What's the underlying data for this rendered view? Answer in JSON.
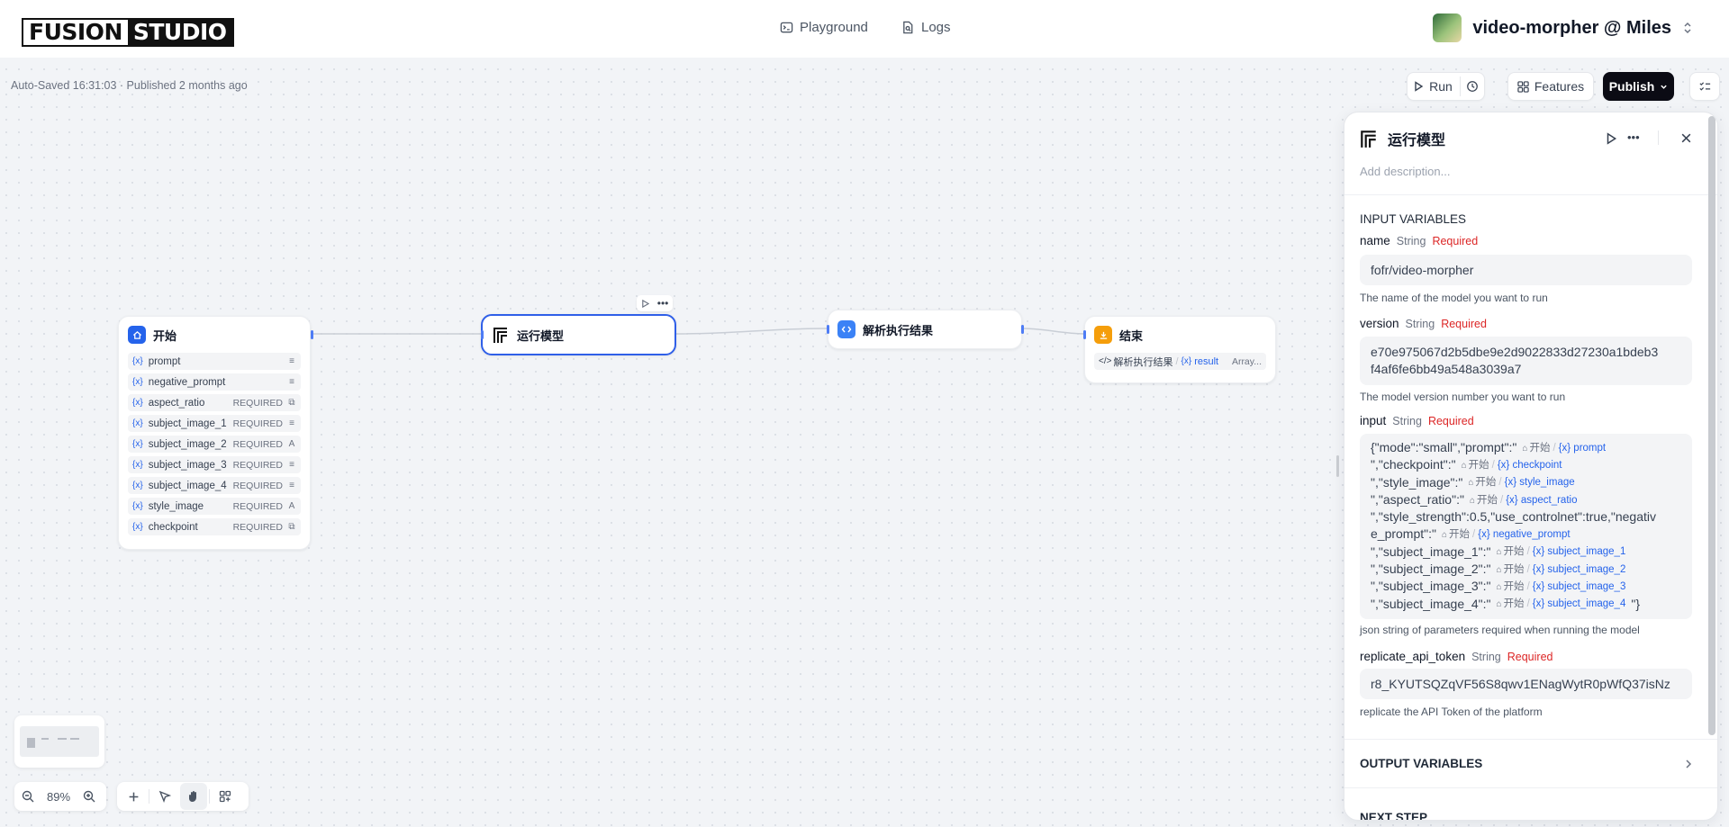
{
  "header": {
    "logo_left": "FUSION",
    "logo_right": "STUDIO",
    "tabs": [
      {
        "label": "Playground",
        "icon": "terminal-icon"
      },
      {
        "label": "Logs",
        "icon": "file-search-icon"
      }
    ],
    "app_name": "video-morpher @ Miles"
  },
  "toolbar": {
    "autosave": "Auto-Saved 16:31:03 · Published 2 months ago",
    "run_label": "Run",
    "features_label": "Features",
    "publish_label": "Publish"
  },
  "nodes": {
    "start": {
      "title": "开始",
      "vars": [
        {
          "name": "prompt",
          "required": "",
          "type_icon": "≡"
        },
        {
          "name": "negative_prompt",
          "required": "",
          "type_icon": "≡"
        },
        {
          "name": "aspect_ratio",
          "required": "REQUIRED",
          "type_icon": "⧉"
        },
        {
          "name": "subject_image_1",
          "required": "REQUIRED",
          "type_icon": "≡"
        },
        {
          "name": "subject_image_2",
          "required": "REQUIRED",
          "type_icon": "A"
        },
        {
          "name": "subject_image_3",
          "required": "REQUIRED",
          "type_icon": "≡"
        },
        {
          "name": "subject_image_4",
          "required": "REQUIRED",
          "type_icon": "≡"
        },
        {
          "name": "style_image",
          "required": "REQUIRED",
          "type_icon": "A"
        },
        {
          "name": "checkpoint",
          "required": "REQUIRED",
          "type_icon": "⧉"
        }
      ]
    },
    "run_model": {
      "title": "运行模型"
    },
    "parse": {
      "title": "解析执行结果"
    },
    "end": {
      "title": "结束",
      "output_source": "解析执行结果",
      "output_var": "result",
      "output_type": "Array..."
    }
  },
  "panel": {
    "title": "运行模型",
    "description_placeholder": "Add description...",
    "input_header": "INPUT VARIABLES",
    "fields": [
      {
        "label": "name",
        "type": "String",
        "required": "Required",
        "value": "fofr/video-morpher",
        "description": "The name of the model you want to run"
      },
      {
        "label": "version",
        "type": "String",
        "required": "Required",
        "value_line1": "e70e975067d2b5dbe9e2d9022833d27230a1bdeb3",
        "value_line2": "f4af6fe6bb49a548a3039a7",
        "description": "The model version number you want to run"
      },
      {
        "label": "input",
        "type": "String",
        "required": "Required",
        "description": "json string of parameters required when running the model"
      },
      {
        "label": "replicate_api_token",
        "type": "String",
        "required": "Required",
        "value": "r8_KYUTSQZqVF56S8qwv1ENagWytR0pWfQ37isNz",
        "description": "replicate the API Token of the platform"
      }
    ],
    "input_json": [
      {
        "text": "{\"mode\":\"small\",\"prompt\":\"",
        "src": "开始",
        "var": "prompt"
      },
      {
        "text": "\",\"checkpoint\":\"",
        "src": "开始",
        "var": "checkpoint"
      },
      {
        "text": "\",\"style_image\":\"",
        "src": "开始",
        "var": "style_image"
      },
      {
        "text": "\",\"aspect_ratio\":\"",
        "src": "开始",
        "var": "aspect_ratio"
      },
      {
        "text": "\",\"style_strength\":0.5,\"use_controlnet\":true,\"negativ",
        "src": "",
        "var": ""
      },
      {
        "text": "e_prompt\":\"",
        "src": "开始",
        "var": "negative_prompt"
      },
      {
        "text": "\",\"subject_image_1\":\"",
        "src": "开始",
        "var": "subject_image_1"
      },
      {
        "text": "\",\"subject_image_2\":\"",
        "src": "开始",
        "var": "subject_image_2"
      },
      {
        "text": "\",\"subject_image_3\":\"",
        "src": "开始",
        "var": "subject_image_3"
      },
      {
        "text": "\",\"subject_image_4\":\"",
        "src": "开始",
        "var": "subject_image_4",
        "tail": "\"}"
      }
    ],
    "output_header": "OUTPUT VARIABLES",
    "next_header": "NEXT STEP"
  },
  "zoom": {
    "level": "89%"
  },
  "colors": {
    "accent": "#2563eb",
    "required": "#dc2626",
    "publish": "#0b0b14"
  }
}
